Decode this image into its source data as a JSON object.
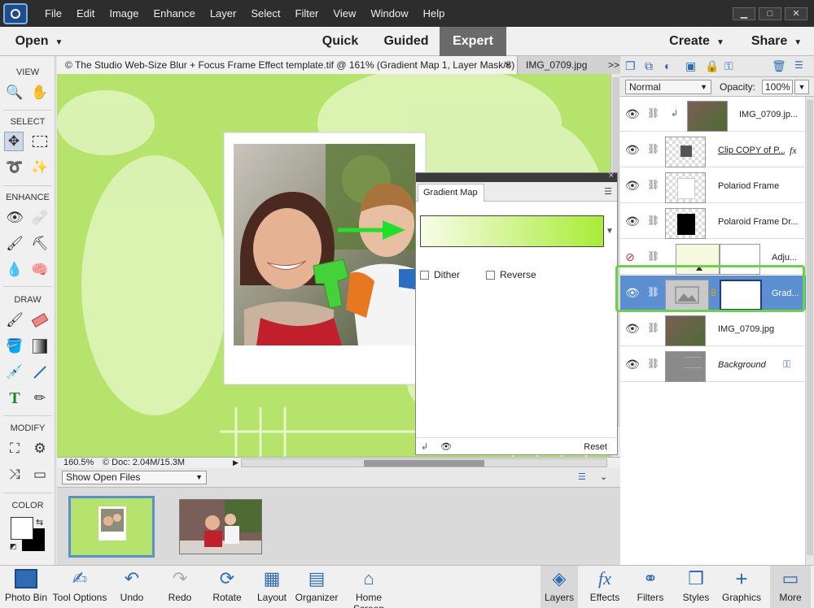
{
  "menubar": {
    "items": [
      "File",
      "Edit",
      "Image",
      "Enhance",
      "Layer",
      "Select",
      "Filter",
      "View",
      "Window",
      "Help"
    ],
    "window_controls": [
      "▁",
      "□",
      "✕"
    ]
  },
  "modebar": {
    "open_label": "Open",
    "modes": [
      "Quick",
      "Guided",
      "Expert"
    ],
    "active_mode": "Expert",
    "create_label": "Create",
    "share_label": "Share"
  },
  "toolbox": {
    "sections": [
      "VIEW",
      "SELECT",
      "ENHANCE",
      "DRAW",
      "MODIFY",
      "COLOR"
    ]
  },
  "doc_tabs": {
    "active": "© The Studio Web-Size Blur + Focus Frame Effect template.tif @ 161% (Gradient Map 1, Layer Mask/8) *",
    "close": "×",
    "other": "IMG_0709.jpg",
    "overflow": ">>"
  },
  "status": {
    "zoom": "160.5%",
    "doc": "© Doc: 2.04M/15.3M"
  },
  "photo_bin": {
    "select_value": "Show Open Files"
  },
  "layers_panel": {
    "blend_mode": "Normal",
    "opacity_label": "Opacity:",
    "opacity_value": "100%",
    "layers": [
      {
        "name": "IMG_0709.jp..."
      },
      {
        "name": "Clip COPY of P...",
        "fx": "fx"
      },
      {
        "name": "Polariod Frame"
      },
      {
        "name": "Polaroid Frame Dr..."
      },
      {
        "name": "Adju..."
      },
      {
        "name": "Grad..."
      },
      {
        "name": "IMG_0709.jpg"
      },
      {
        "name": "Background"
      }
    ]
  },
  "gradient_map": {
    "tab_label": "Gradient Map",
    "dither_label": "Dither",
    "reverse_label": "Reverse",
    "reset_label": "Reset",
    "close": "×",
    "colors": {
      "start": "#f8fde8",
      "end": "#a9ec38"
    }
  },
  "bottombar": {
    "photo_bin": "Photo Bin",
    "tool_options": "Tool Options",
    "undo": "Undo",
    "redo": "Redo",
    "rotate": "Rotate",
    "layout": "Layout",
    "organizer": "Organizer",
    "home_screen": "Home Screen",
    "layers": "Layers",
    "effects": "Effects",
    "filters": "Filters",
    "styles": "Styles",
    "graphics": "Graphics",
    "more": "More"
  },
  "colors": {
    "canvas_green": "#b6e36c",
    "accent_blue": "#5b8fd2",
    "highlight_green": "#6cd24a",
    "arrow_green": "#22e02a"
  }
}
